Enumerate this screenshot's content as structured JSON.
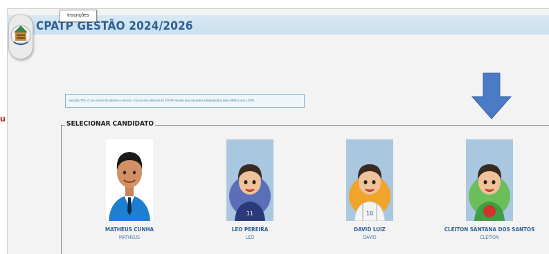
{
  "header": {
    "title": "CPATP GESTÃO 2024/2026",
    "tab_label": "Inscrições"
  },
  "side_mark": "u",
  "notice": {
    "text": "Atenção TPA: O seu voto é facultativo e secreto. O processo eleitoral da CPATP atende aos requisitos estabelecidos pela NR05 e seu LGPD."
  },
  "section": {
    "label": "SELECIONAR CANDIDATO"
  },
  "candidates": [
    {
      "name": "MATHEUS CUNHA",
      "nickname": "MATHEUS",
      "avatar": "man-suit-avatar-icon"
    },
    {
      "name": "LEO PEREIRA",
      "nickname": "LEO",
      "avatar": "boy-jersey-11-avatar-icon"
    },
    {
      "name": "DAVID LUIZ",
      "nickname": "DAVID",
      "avatar": "boy-jersey-10-avatar-icon"
    },
    {
      "name": "CLEITON SANTANA DOS SANTOS",
      "nickname": "CLEITON",
      "avatar": "boy-green-shirt-avatar-icon"
    }
  ],
  "colors": {
    "header_band": "#c9e0ee",
    "title": "#2f5f95",
    "arrow": "#4a7bc4",
    "notice_border": "#7fb0d0"
  }
}
